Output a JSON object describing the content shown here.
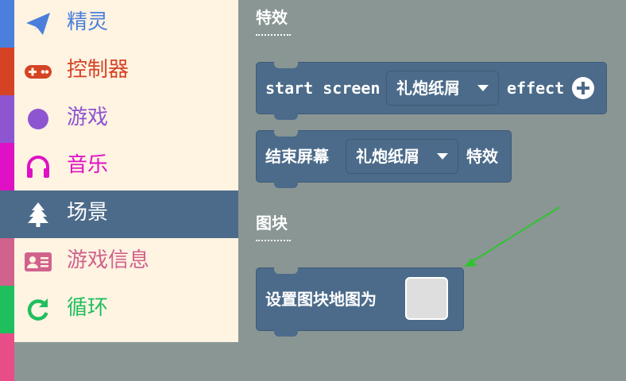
{
  "colors": {
    "sprites": "#4a7fdb",
    "controller": "#d54324",
    "game": "#8e55d0",
    "music": "#e010c4",
    "scene": "#4c6b8a",
    "info": "#d0628c",
    "loops": "#20bf5e",
    "flyout_bg": "#8a9694",
    "block": "#4c6b8a",
    "arrow": "#2ec42e"
  },
  "categories": [
    {
      "label": "精灵",
      "icon": "paper-plane-icon"
    },
    {
      "label": "控制器",
      "icon": "gamepad-icon"
    },
    {
      "label": "游戏",
      "icon": "circle-icon"
    },
    {
      "label": "音乐",
      "icon": "headphones-icon"
    },
    {
      "label": "场景",
      "icon": "tree-icon",
      "selected": true
    },
    {
      "label": "游戏信息",
      "icon": "id-card-icon"
    },
    {
      "label": "循环",
      "icon": "refresh-icon"
    }
  ],
  "flyout": {
    "section1": {
      "title": "特效"
    },
    "block1": {
      "prefix": "start screen",
      "dropdown": "礼炮纸屑",
      "suffix": "effect"
    },
    "block2": {
      "prefix": "结束屏幕",
      "dropdown": "礼炮纸屑",
      "suffix": "特效"
    },
    "section2": {
      "title": "图块"
    },
    "block3": {
      "prefix": "设置图块地图为"
    }
  }
}
